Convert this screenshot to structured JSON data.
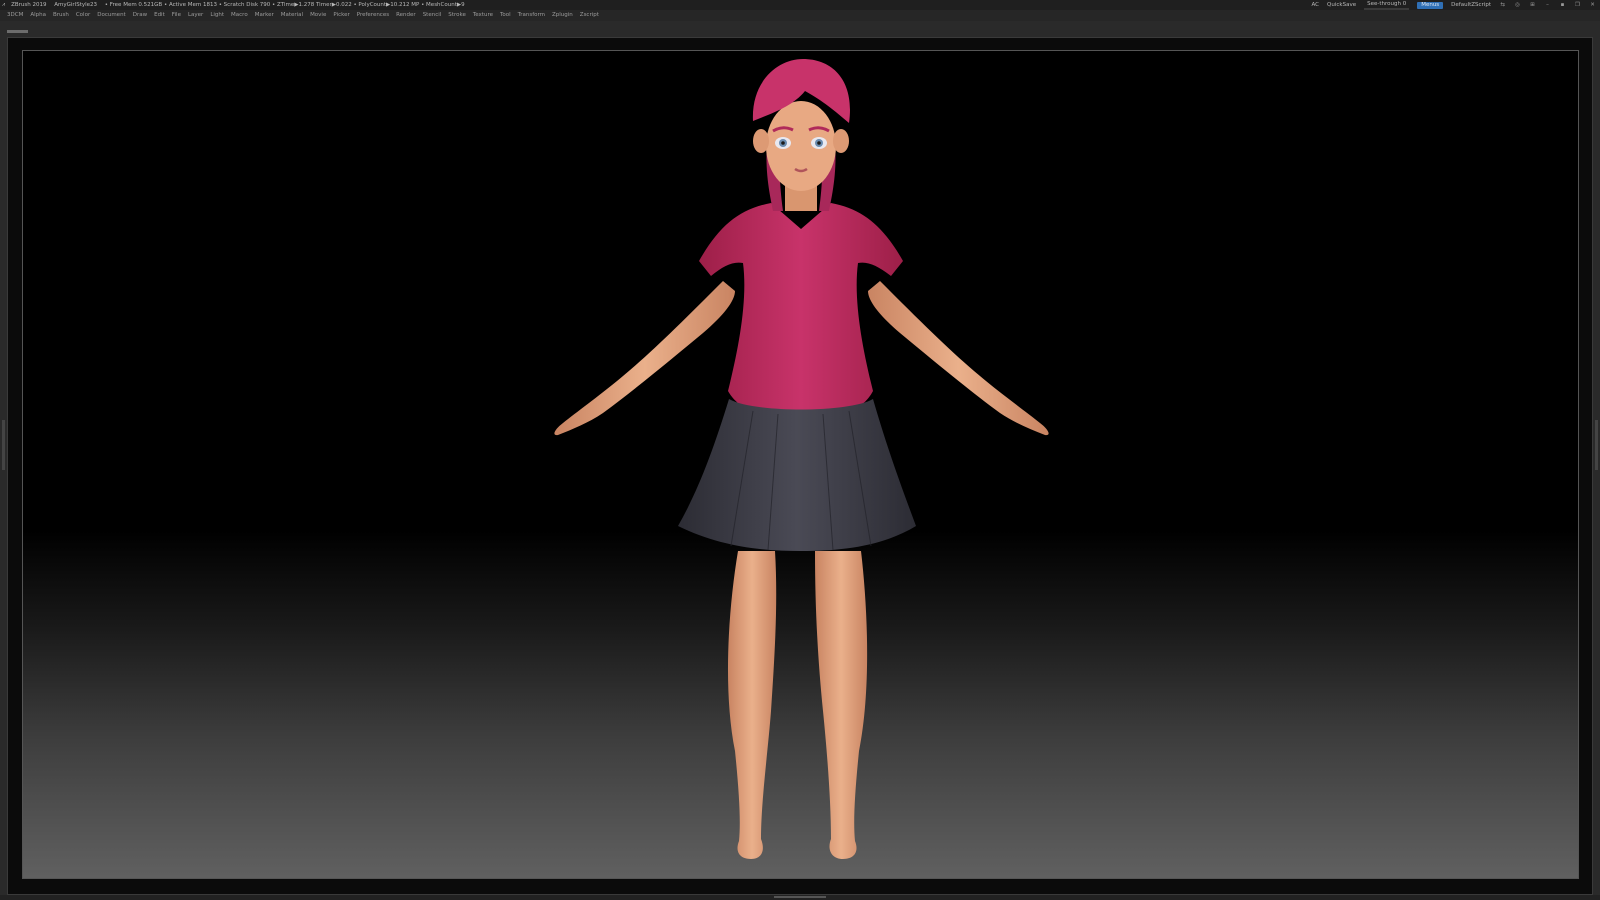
{
  "titlebar": {
    "app": "ZBrush 2019",
    "project": "AmyGirlStyle23",
    "stats": "• Free Mem 0.521GB • Active Mem 1813 • Scratch Disk 790 • ZTime▶1.278 Timer▶0.022 • PolyCount▶10.212 MP • MeshCount▶9",
    "ac": "AC",
    "quicksave": "QuickSave",
    "see_through_label": "See-through",
    "see_through_value": "0",
    "see_through_fraction": 0.0,
    "menus_button": "Menus",
    "script": "DefaultZScript"
  },
  "menubar": {
    "items": [
      "3DCM",
      "Alpha",
      "Brush",
      "Color",
      "Document",
      "Draw",
      "Edit",
      "File",
      "Layer",
      "Light",
      "Macro",
      "Marker",
      "Material",
      "Movie",
      "Picker",
      "Preferences",
      "Render",
      "Stencil",
      "Stroke",
      "Texture",
      "Tool",
      "Transform",
      "Zplugin",
      "Zscript"
    ]
  },
  "colors": {
    "shirt": "#c02a5c",
    "hair": "#c8336a",
    "skin": "#e6a57f",
    "skirt": "#3c3c46",
    "menu_button": "#2f6fb5",
    "see_through_fill": "#e0a030"
  }
}
